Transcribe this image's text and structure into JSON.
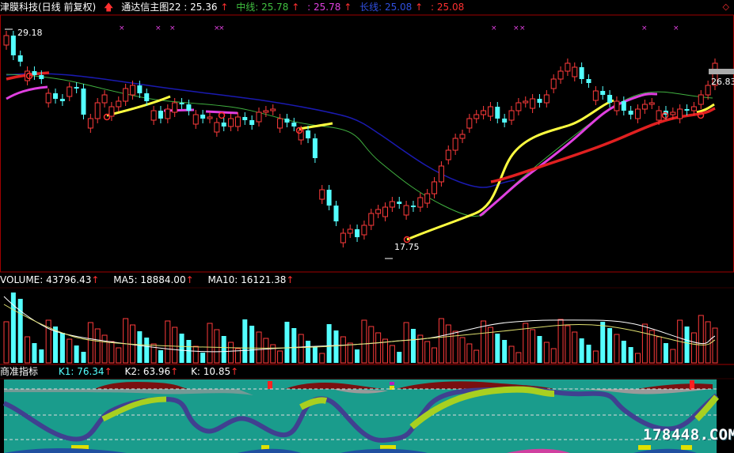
{
  "main_panel": {
    "stock_name": "津膜科技(日线 前复权)",
    "indicator_name": "通达信主图22",
    "indicator_value": ": 25.36",
    "mid_label": "中线: 25.78",
    "mid_value2": ": 25.78",
    "long_label": "长线: 25.08",
    "long_value2": ": 25.08",
    "arrow": "↑",
    "high_label": "29.18",
    "low_label": "17.75",
    "last_price": "26.83"
  },
  "volume_panel": {
    "vol_label": "VOLUME: 43796.43",
    "ma5_label": "MA5: 18884.00",
    "ma10_label": "MA10: 16121.38"
  },
  "indicator_panel": {
    "name": "商准指标",
    "k1_label": "K1: 76.34",
    "k2_label": "K2: 63.96",
    "k_label": "K: 10.85"
  },
  "watermark": "178448.COM",
  "colors": {
    "bull": "#ff3b3b",
    "bear": "#54ffff",
    "ma_yellow": "#ffff40",
    "ma_magenta": "#e040e0",
    "ma_red": "#e02020",
    "ma_green": "#40c040",
    "ma_blue": "#2020c0",
    "teal": "#1a9c8c"
  },
  "chart_data": {
    "type": "candlestick",
    "price_high": 29.18,
    "price_low": 17.75,
    "last_close": 26.83
  }
}
